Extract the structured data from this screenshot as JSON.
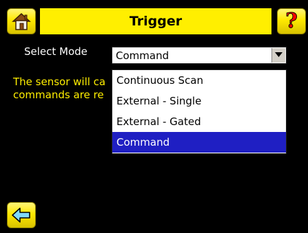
{
  "header": {
    "title": "Trigger",
    "home_icon": "home-icon",
    "help_icon": "help-icon",
    "help_glyph": "?"
  },
  "mode": {
    "label": "Select Mode",
    "selected_value": "Command",
    "arrow_icon": "chevron-down-icon"
  },
  "description": {
    "line1": "The sensor will ca",
    "line2": "commands are re"
  },
  "dropdown": {
    "options": [
      "Continuous Scan",
      "External - Single",
      "External - Gated",
      "Command"
    ],
    "selected_index": 3
  },
  "footer": {
    "back_icon": "back-arrow-icon"
  },
  "colors": {
    "accent_yellow": "#ffef00",
    "selection_blue": "#1f1fc3",
    "description_text": "#ffee00"
  }
}
